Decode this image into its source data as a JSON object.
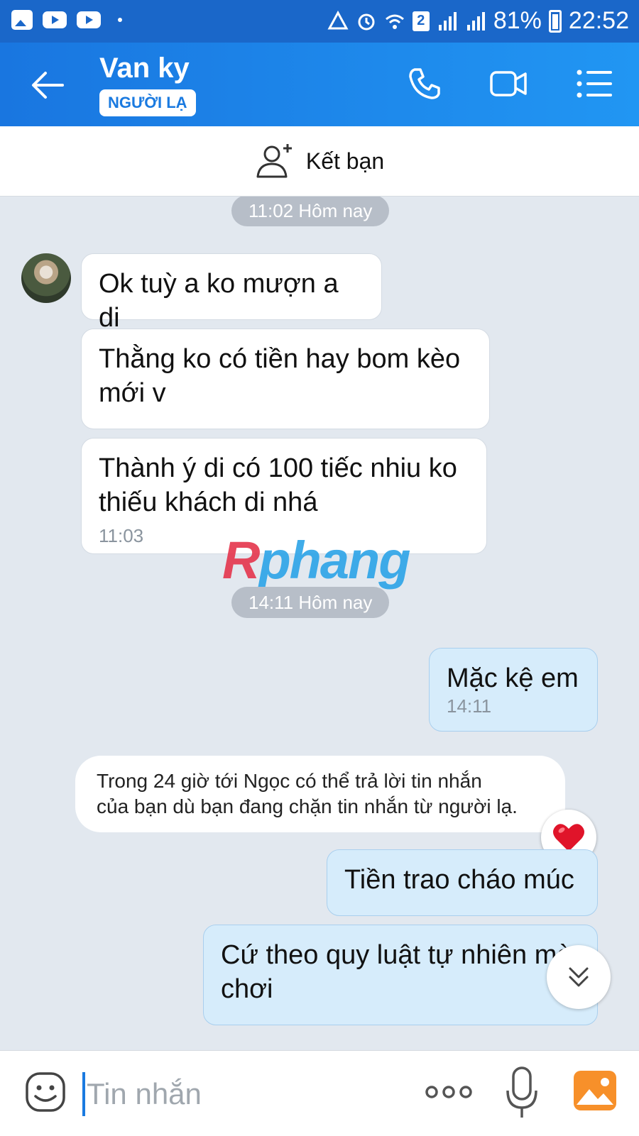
{
  "status_bar": {
    "sim_badge": "2",
    "battery": "81%",
    "time": "22:52"
  },
  "header": {
    "contact_name": "Van ky",
    "stranger_tag": "NGƯỜI LẠ"
  },
  "friend_bar": {
    "label": "Kết bạn"
  },
  "chat": {
    "time_separators": [
      "11:02 Hôm nay",
      "14:11 Hôm nay"
    ],
    "messages": [
      {
        "direction": "in",
        "text": "Ok tuỳ a ko mượn a di"
      },
      {
        "direction": "in",
        "text": "Thằng ko có tiền hay bom kèo\nmới v"
      },
      {
        "direction": "in",
        "text": "Thành ý di có 100 tiếc nhiu ko\nthiếu khách di nhá",
        "time": "11:03"
      },
      {
        "direction": "out",
        "text": "Mặc kệ em",
        "time": "14:11"
      },
      {
        "direction": "out",
        "text": "Tiền trao cháo múc"
      },
      {
        "direction": "out",
        "text": "Cứ theo quy luật tự nhiên mà\nchơi"
      }
    ],
    "notice": "Trong 24 giờ tới Ngọc có thể trả lời tin nhắn\ncủa bạn dù bạn đang chặn tin nhắn từ người lạ.",
    "watermark": {
      "part1": "R",
      "part2": "phang"
    }
  },
  "input_bar": {
    "placeholder": "Tin nhắn"
  },
  "colors": {
    "header": "#1a7ae0",
    "outgoing_bubble": "#d6ecfb",
    "chat_bg": "#e2e8ef"
  }
}
